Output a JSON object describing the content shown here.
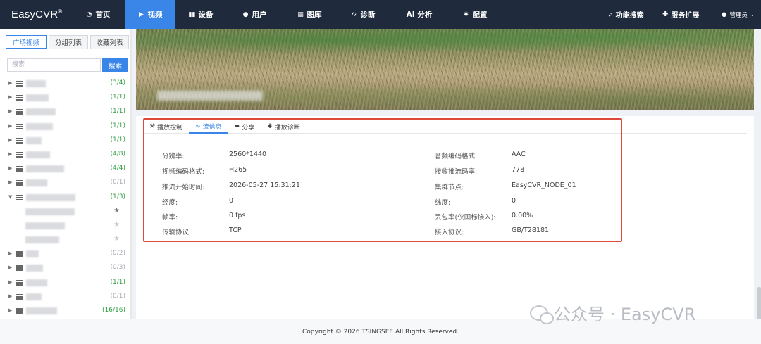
{
  "brand": "EasyCVR",
  "brand_mark": "®",
  "nav": [
    {
      "label": "首页",
      "icon": "dashboard-icon",
      "glyph": "◔"
    },
    {
      "label": "视频",
      "icon": "play-circle-icon",
      "glyph": "▶",
      "active": true
    },
    {
      "label": "设备",
      "icon": "device-icon",
      "glyph": "▮▮"
    },
    {
      "label": "用户",
      "icon": "user-icon",
      "glyph": "●"
    },
    {
      "label": "图库",
      "icon": "gallery-icon",
      "glyph": "▦"
    },
    {
      "label": "诊断",
      "icon": "pulse-icon",
      "glyph": "∿"
    },
    {
      "label": "AI 分析",
      "icon": "",
      "glyph": ""
    },
    {
      "label": "配置",
      "icon": "gear-icon",
      "glyph": "✱"
    }
  ],
  "nav_right": {
    "search": "功能搜索",
    "extend": "服务扩展",
    "user": "管理员"
  },
  "sidebar": {
    "tabs": [
      "广场视频",
      "分组列表",
      "收藏列表"
    ],
    "active_tab": 0,
    "search_placeholder": "搜索",
    "search_button": "搜索",
    "tree": [
      {
        "count": "(3/4)",
        "online": true
      },
      {
        "count": "(1/1)",
        "online": true
      },
      {
        "count": "(1/1)",
        "online": true
      },
      {
        "count": "(1/1)",
        "online": true
      },
      {
        "count": "(1/1)",
        "online": true
      },
      {
        "count": "(4/8)",
        "online": true
      },
      {
        "count": "(4/4)",
        "online": true
      },
      {
        "count": "(0/1)",
        "online": false
      },
      {
        "count": "(1/3)",
        "online": true,
        "expanded": true,
        "children": [
          {
            "starred": true
          },
          {
            "starred": false
          },
          {
            "starred": false
          }
        ]
      },
      {
        "count": "(0/2)",
        "online": false
      },
      {
        "count": "(0/3)",
        "online": false
      },
      {
        "count": "(1/1)",
        "online": true
      },
      {
        "count": "(0/1)",
        "online": false
      },
      {
        "count": "(16/16)",
        "online": true
      }
    ]
  },
  "panel": {
    "tabs": [
      {
        "label": "播放控制",
        "icon": "tools-icon"
      },
      {
        "label": "流信息",
        "icon": "pulse-icon",
        "active": true
      },
      {
        "label": "分享",
        "icon": "share-icon"
      },
      {
        "label": "播放诊断",
        "icon": "gear-icon"
      }
    ],
    "left": [
      {
        "label": "分辨率:",
        "value": "2560*1440"
      },
      {
        "label": "视频编码格式:",
        "value": "H265"
      },
      {
        "label": "推流开始时间:",
        "value": "2026-05-27 15:31:21"
      },
      {
        "label": "经度:",
        "value": "0"
      },
      {
        "label": "帧率:",
        "value": "0 fps"
      },
      {
        "label": "传输协议:",
        "value": "TCP"
      }
    ],
    "right": [
      {
        "label": "音频编码格式:",
        "value": "AAC"
      },
      {
        "label": "接收推流码率:",
        "value": "778"
      },
      {
        "label": "集群节点:",
        "value": "EasyCVR_NODE_01"
      },
      {
        "label": "纬度:",
        "value": "0"
      },
      {
        "label": "丢包率(仅国标接入):",
        "value": "0.00%"
      },
      {
        "label": "接入协议:",
        "value": "GB/T28181"
      }
    ]
  },
  "footer": "Copyright © 2026 TSINGSEE All Rights Reserved.",
  "watermark": "公众号 · EasyCVR",
  "colors": {
    "accent": "#3a86e8",
    "nav_bg": "#1f2a3d",
    "online": "#2e9e3e",
    "offline": "#a8acb3",
    "highlight_box": "#e04a3a"
  }
}
